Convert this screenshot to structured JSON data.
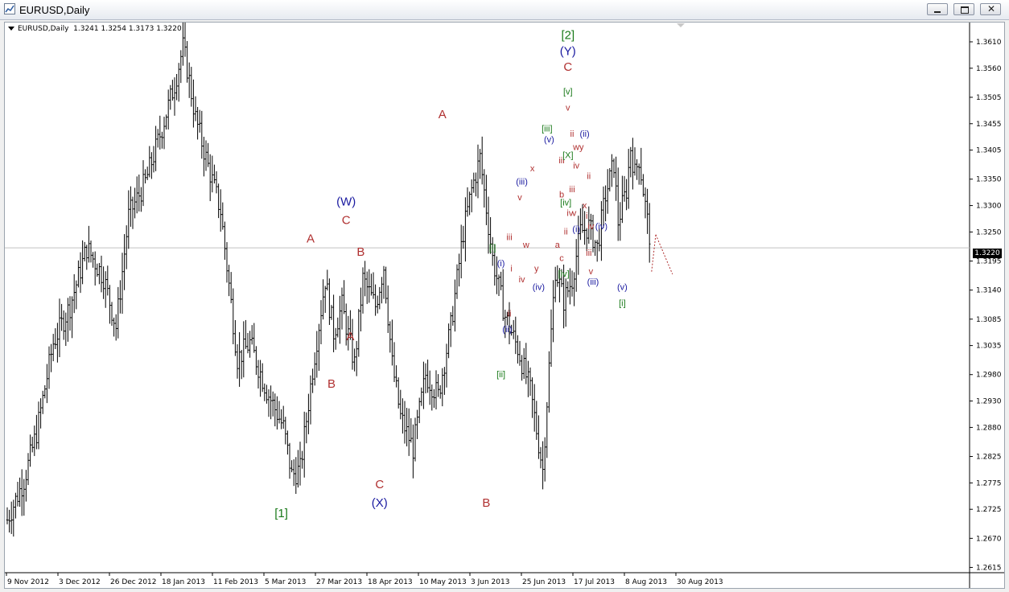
{
  "window": {
    "title": "EURUSD,Daily",
    "buttons": [
      "minimize",
      "restore",
      "close"
    ],
    "colors": {
      "bg": "#ffffff",
      "bars": "#000000",
      "wave_red": "#b03030",
      "wave_blue": "#1a1aa0",
      "wave_green": "#1a7a1a",
      "price_line": "#c0c0c0"
    }
  },
  "symbol": {
    "text": "EURUSD,Daily",
    "ohlc": "1.3241 1.3254 1.3173 1.3220"
  },
  "price_tag": "1.3220",
  "chart_data": {
    "type": "ohlc-bar",
    "symbol": "EURUSD",
    "timeframe": "Daily",
    "x_ticks": [
      "9 Nov 2012",
      "3 Dec 2012",
      "26 Dec 2012",
      "18 Jan 2013",
      "11 Feb 2013",
      "5 Mar 2013",
      "27 Mar 2013",
      "18 Apr 2013",
      "10 May 2013",
      "3 Jun 2013",
      "25 Jun 2013",
      "17 Jul 2013",
      "8 Aug 2013",
      "30 Aug 2013"
    ],
    "y_ticks": [
      "1.3610",
      "1.3560",
      "1.3505",
      "1.3455",
      "1.3405",
      "1.3350",
      "1.3300",
      "1.3250",
      "1.3195",
      "1.3140",
      "1.3085",
      "1.3035",
      "1.2980",
      "1.2930",
      "1.2880",
      "1.2825",
      "1.2775",
      "1.2725",
      "1.2670",
      "1.2615"
    ],
    "ylim": [
      1.2605,
      1.3645
    ],
    "last_price": 1.322,
    "path": [
      {
        "i": 0,
        "p": 1.2705
      },
      {
        "i": 8,
        "p": 1.278
      },
      {
        "i": 14,
        "p": 1.287
      },
      {
        "i": 22,
        "p": 1.304
      },
      {
        "i": 30,
        "p": 1.311
      },
      {
        "i": 38,
        "p": 1.322
      },
      {
        "i": 46,
        "p": 1.3165
      },
      {
        "i": 52,
        "p": 1.307
      },
      {
        "i": 58,
        "p": 1.328
      },
      {
        "i": 66,
        "p": 1.3345
      },
      {
        "i": 72,
        "p": 1.342
      },
      {
        "i": 80,
        "p": 1.353
      },
      {
        "i": 84,
        "p": 1.36
      },
      {
        "i": 86,
        "p": 1.356
      },
      {
        "i": 90,
        "p": 1.3465
      },
      {
        "i": 96,
        "p": 1.3375
      },
      {
        "i": 102,
        "p": 1.329
      },
      {
        "i": 110,
        "p": 1.301
      },
      {
        "i": 116,
        "p": 1.304
      },
      {
        "i": 124,
        "p": 1.295
      },
      {
        "i": 132,
        "p": 1.288
      },
      {
        "i": 136,
        "p": 1.279
      },
      {
        "i": 140,
        "p": 1.28
      },
      {
        "i": 146,
        "p": 1.299
      },
      {
        "i": 152,
        "p": 1.316
      },
      {
        "i": 156,
        "p": 1.306
      },
      {
        "i": 160,
        "p": 1.311
      },
      {
        "i": 166,
        "p": 1.3
      },
      {
        "i": 170,
        "p": 1.316
      },
      {
        "i": 176,
        "p": 1.311
      },
      {
        "i": 180,
        "p": 1.3185
      },
      {
        "i": 184,
        "p": 1.3
      },
      {
        "i": 188,
        "p": 1.29
      },
      {
        "i": 194,
        "p": 1.284
      },
      {
        "i": 200,
        "p": 1.298
      },
      {
        "i": 206,
        "p": 1.294
      },
      {
        "i": 212,
        "p": 1.307
      },
      {
        "i": 218,
        "p": 1.325
      },
      {
        "i": 222,
        "p": 1.333
      },
      {
        "i": 226,
        "p": 1.339
      },
      {
        "i": 232,
        "p": 1.32
      },
      {
        "i": 238,
        "p": 1.309
      },
      {
        "i": 244,
        "p": 1.303
      },
      {
        "i": 250,
        "p": 1.295
      },
      {
        "i": 256,
        "p": 1.28
      },
      {
        "i": 260,
        "p": 1.306
      },
      {
        "i": 262,
        "p": 1.318
      },
      {
        "i": 266,
        "p": 1.312
      },
      {
        "i": 270,
        "p": 1.316
      },
      {
        "i": 274,
        "p": 1.325
      },
      {
        "i": 278,
        "p": 1.326
      },
      {
        "i": 282,
        "p": 1.322
      },
      {
        "i": 286,
        "p": 1.332
      },
      {
        "i": 290,
        "p": 1.338
      },
      {
        "i": 292,
        "p": 1.327
      },
      {
        "i": 296,
        "p": 1.333
      },
      {
        "i": 298,
        "p": 1.341
      },
      {
        "i": 300,
        "p": 1.336
      },
      {
        "i": 302,
        "p": 1.339
      },
      {
        "i": 304,
        "p": 1.333
      },
      {
        "i": 306,
        "p": 1.327
      },
      {
        "i": 308,
        "p": 1.322
      }
    ],
    "projection": [
      {
        "i": 308,
        "p": 1.3175
      },
      {
        "i": 310,
        "p": 1.3245
      },
      {
        "i": 318,
        "p": 1.317
      }
    ],
    "annotations": [
      {
        "t": "[1]",
        "c": "green",
        "i": 131,
        "p": 1.271
      },
      {
        "t": "A",
        "c": "red",
        "i": 145,
        "p": 1.323
      },
      {
        "t": "B",
        "c": "red",
        "i": 155,
        "p": 1.2955
      },
      {
        "t": "(W)",
        "c": "blue",
        "i": 162,
        "p": 1.33
      },
      {
        "t": "C",
        "c": "red",
        "i": 162,
        "p": 1.3265
      },
      {
        "t": "A",
        "c": "red",
        "i": 164,
        "p": 1.3045
      },
      {
        "t": "B",
        "c": "red",
        "i": 169,
        "p": 1.3205
      },
      {
        "t": "C",
        "c": "red",
        "i": 178,
        "p": 1.2765
      },
      {
        "t": "(X)",
        "c": "blue",
        "i": 178,
        "p": 1.273
      },
      {
        "t": "A",
        "c": "red",
        "i": 208,
        "p": 1.3465
      },
      {
        "t": "B",
        "c": "red",
        "i": 229,
        "p": 1.273
      },
      {
        "t": "[i]",
        "c": "green",
        "i": 232,
        "p": 1.3215
      },
      {
        "t": "(i)",
        "c": "blue",
        "i": 236,
        "p": 1.3185
      },
      {
        "t": "[ii]",
        "c": "green",
        "i": 236,
        "p": 1.2975
      },
      {
        "t": "(ii)",
        "c": "blue",
        "i": 239,
        "p": 1.306
      },
      {
        "t": "i",
        "c": "red",
        "i": 241,
        "p": 1.3175
      },
      {
        "t": "ii",
        "c": "red",
        "i": 240,
        "p": 1.309
      },
      {
        "t": "iii",
        "c": "red",
        "i": 240,
        "p": 1.3235
      },
      {
        "t": "iv",
        "c": "red",
        "i": 246,
        "p": 1.3155
      },
      {
        "t": "(iii)",
        "c": "blue",
        "i": 246,
        "p": 1.334
      },
      {
        "t": "v",
        "c": "red",
        "i": 245,
        "p": 1.331
      },
      {
        "t": "w",
        "c": "red",
        "i": 248,
        "p": 1.322
      },
      {
        "t": "x",
        "c": "red",
        "i": 251,
        "p": 1.3365
      },
      {
        "t": "y",
        "c": "red",
        "i": 253,
        "p": 1.3175
      },
      {
        "t": "(iv)",
        "c": "blue",
        "i": 254,
        "p": 1.314
      },
      {
        "t": "[iii]",
        "c": "green",
        "i": 258,
        "p": 1.344
      },
      {
        "t": "(v)",
        "c": "blue",
        "i": 259,
        "p": 1.342
      },
      {
        "t": "iii",
        "c": "red",
        "i": 265,
        "p": 1.338
      },
      {
        "t": "a",
        "c": "red",
        "i": 263,
        "p": 1.322
      },
      {
        "t": "c",
        "c": "red",
        "i": 265,
        "p": 1.3195
      },
      {
        "t": "[iv]",
        "c": "green",
        "i": 266,
        "p": 1.3165
      },
      {
        "t": "b",
        "c": "red",
        "i": 265,
        "p": 1.3315
      },
      {
        "t": "ii",
        "c": "red",
        "i": 267,
        "p": 1.3245
      },
      {
        "t": "[iv]",
        "c": "green",
        "i": 267,
        "p": 1.33
      },
      {
        "t": "[v]",
        "c": "green",
        "i": 268,
        "p": 1.351
      },
      {
        "t": "v",
        "c": "red",
        "i": 268,
        "p": 1.348
      },
      {
        "t": "[X]",
        "c": "green",
        "i": 268,
        "p": 1.339
      },
      {
        "t": "iv",
        "c": "red",
        "i": 269,
        "p": 1.328
      },
      {
        "t": "v",
        "c": "red",
        "i": 271,
        "p": 1.328
      },
      {
        "t": "iii",
        "c": "red",
        "i": 270,
        "p": 1.3325
      },
      {
        "t": "ii",
        "c": "red",
        "i": 270,
        "p": 1.343
      },
      {
        "t": "iv",
        "c": "red",
        "i": 272,
        "p": 1.337
      },
      {
        "t": "[2]",
        "c": "green",
        "i": 268,
        "p": 1.3615
      },
      {
        "t": "(Y)",
        "c": "blue",
        "i": 268,
        "p": 1.3585
      },
      {
        "t": "C",
        "c": "red",
        "i": 268,
        "p": 1.3555
      },
      {
        "t": "wy",
        "c": "red",
        "i": 273,
        "p": 1.3405
      },
      {
        "t": "(ii)",
        "c": "blue",
        "i": 276,
        "p": 1.343
      },
      {
        "t": "(i)",
        "c": "blue",
        "i": 272,
        "p": 1.325
      },
      {
        "t": "x",
        "c": "red",
        "i": 276,
        "p": 1.3295
      },
      {
        "t": "i",
        "c": "red",
        "i": 277,
        "p": 1.3275
      },
      {
        "t": "ii",
        "c": "red",
        "i": 278,
        "p": 1.335
      },
      {
        "t": "iv",
        "c": "red",
        "i": 279,
        "p": 1.3255
      },
      {
        "t": "iii",
        "c": "red",
        "i": 278,
        "p": 1.3205
      },
      {
        "t": "v",
        "c": "red",
        "i": 279,
        "p": 1.317
      },
      {
        "t": "(iii)",
        "c": "blue",
        "i": 280,
        "p": 1.315
      },
      {
        "t": "(iv)",
        "c": "blue",
        "i": 284,
        "p": 1.3255
      },
      {
        "t": "(v)",
        "c": "blue",
        "i": 294,
        "p": 1.314
      },
      {
        "t": "[i]",
        "c": "green",
        "i": 294,
        "p": 1.311
      }
    ]
  }
}
